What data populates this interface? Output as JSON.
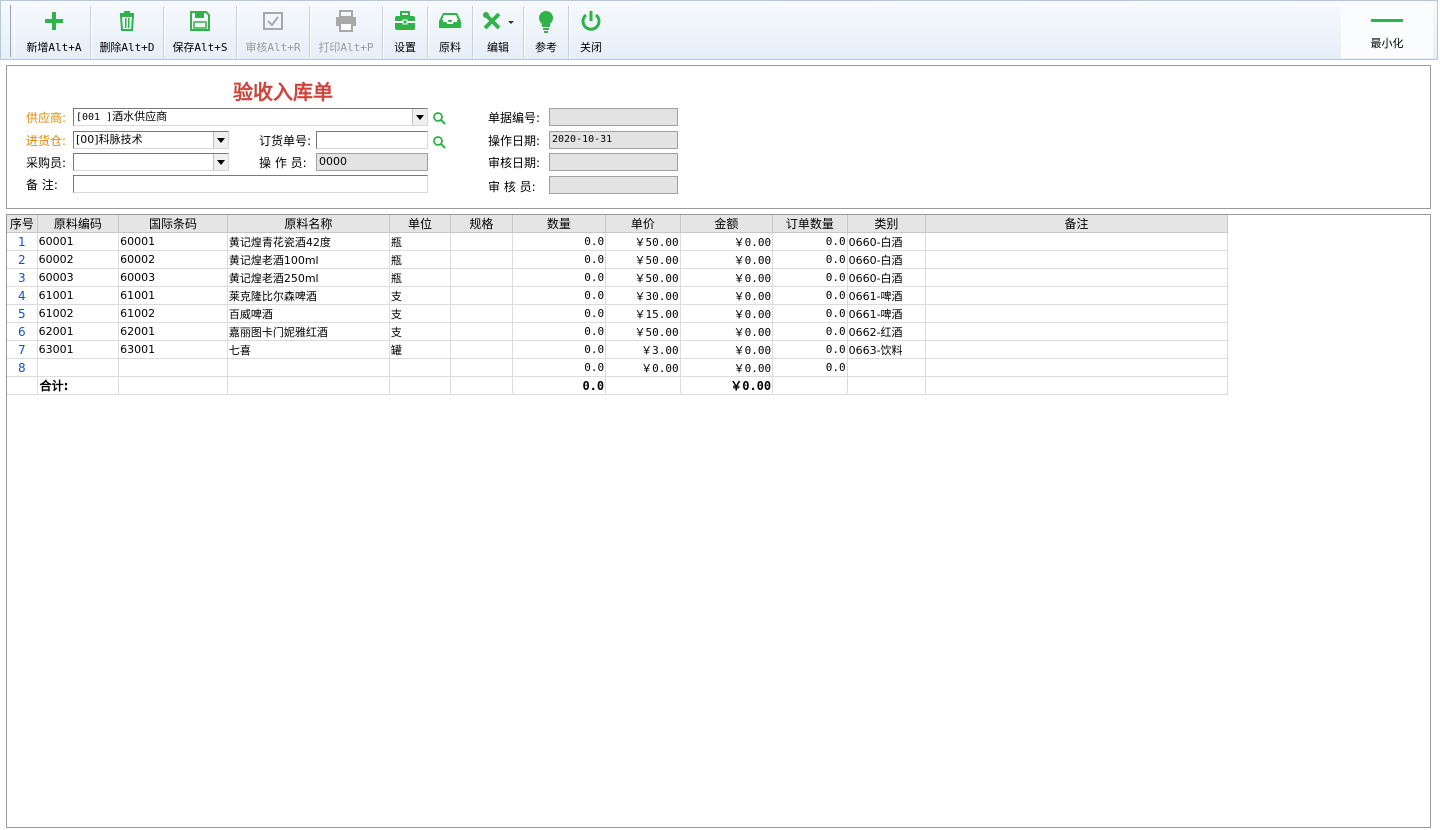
{
  "toolbar": {
    "buttons": [
      {
        "label": "新增Alt+A",
        "icon": "plus-icon",
        "enabled": true
      },
      {
        "label": "删除Alt+D",
        "icon": "trash-icon",
        "enabled": true
      },
      {
        "label": "保存Alt+S",
        "icon": "floppy-disk-icon",
        "enabled": true
      },
      {
        "label": "审核Alt+R",
        "icon": "approve-check-icon",
        "enabled": false
      },
      {
        "label": "打印Alt+P",
        "icon": "printer-icon",
        "enabled": false
      },
      {
        "label": "设置",
        "icon": "toolbox-icon",
        "enabled": true
      },
      {
        "label": "原料",
        "icon": "tray-icon",
        "enabled": true
      },
      {
        "label": "编辑",
        "icon": "edit-tools-icon",
        "enabled": true
      },
      {
        "label": "参考",
        "icon": "lightbulb-icon",
        "enabled": true
      },
      {
        "label": "关闭",
        "icon": "power-icon",
        "enabled": true
      }
    ],
    "minimize_label": "最小化"
  },
  "form": {
    "title": "验收入库单",
    "supplier_label": "供应商:",
    "supplier_code": "[001        ]",
    "supplier_name": "酒水供应商",
    "warehouse_label": "进货仓:",
    "warehouse_value": "[00]科脉技术",
    "order_no_label": "订货单号:",
    "order_no_value": "",
    "buyer_label": "采购员:",
    "buyer_value": "",
    "operator_label": "操 作 员:",
    "operator_value": "0000",
    "remark_label": "备  注:",
    "remark_value": "",
    "doc_no_label": "单据编号:",
    "doc_no_value": "",
    "op_date_label": "操作日期:",
    "op_date_value": "2020-10-31",
    "audit_date_label": "审核日期:",
    "audit_date_value": "",
    "auditor_label": "审 核 员:",
    "auditor_value": ""
  },
  "grid": {
    "columns": [
      "序号",
      "原料编码",
      "国际条码",
      "原料名称",
      "单位",
      "规格",
      "数量",
      "单价",
      "金额",
      "订单数量",
      "类别",
      "备注"
    ],
    "rows": [
      [
        "1",
        "60001",
        "60001",
        "黄记煌青花瓷酒42度",
        "瓶",
        "",
        "0.0",
        "￥50.00",
        "￥0.00",
        "0.0",
        "0660-白酒",
        ""
      ],
      [
        "2",
        "60002",
        "60002",
        "黄记煌老酒100ml",
        "瓶",
        "",
        "0.0",
        "￥50.00",
        "￥0.00",
        "0.0",
        "0660-白酒",
        ""
      ],
      [
        "3",
        "60003",
        "60003",
        "黄记煌老酒250ml",
        "瓶",
        "",
        "0.0",
        "￥50.00",
        "￥0.00",
        "0.0",
        "0660-白酒",
        ""
      ],
      [
        "4",
        "61001",
        "61001",
        "莱克隆比尔森啤酒",
        "支",
        "",
        "0.0",
        "￥30.00",
        "￥0.00",
        "0.0",
        "0661-啤酒",
        ""
      ],
      [
        "5",
        "61002",
        "61002",
        "百威啤酒",
        "支",
        "",
        "0.0",
        "￥15.00",
        "￥0.00",
        "0.0",
        "0661-啤酒",
        ""
      ],
      [
        "6",
        "62001",
        "62001",
        "嘉丽图卡门妮雅红酒",
        "支",
        "",
        "0.0",
        "￥50.00",
        "￥0.00",
        "0.0",
        "0662-红酒",
        ""
      ],
      [
        "7",
        "63001",
        "63001",
        "七喜",
        "罐",
        "",
        "0.0",
        "￥3.00",
        "￥0.00",
        "0.0",
        "0663-饮料",
        ""
      ],
      [
        "8",
        "",
        "",
        "",
        "",
        "",
        "0.0",
        "￥0.00",
        "￥0.00",
        "0.0",
        "",
        ""
      ]
    ],
    "total": {
      "label": "合计:",
      "qty": "0.0",
      "amount": "￥0.00"
    }
  },
  "colors": {
    "title": "#d0433c",
    "required_label": "#e08a00",
    "row_number": "#1a50c8",
    "icon_green": "#2fb34a"
  }
}
